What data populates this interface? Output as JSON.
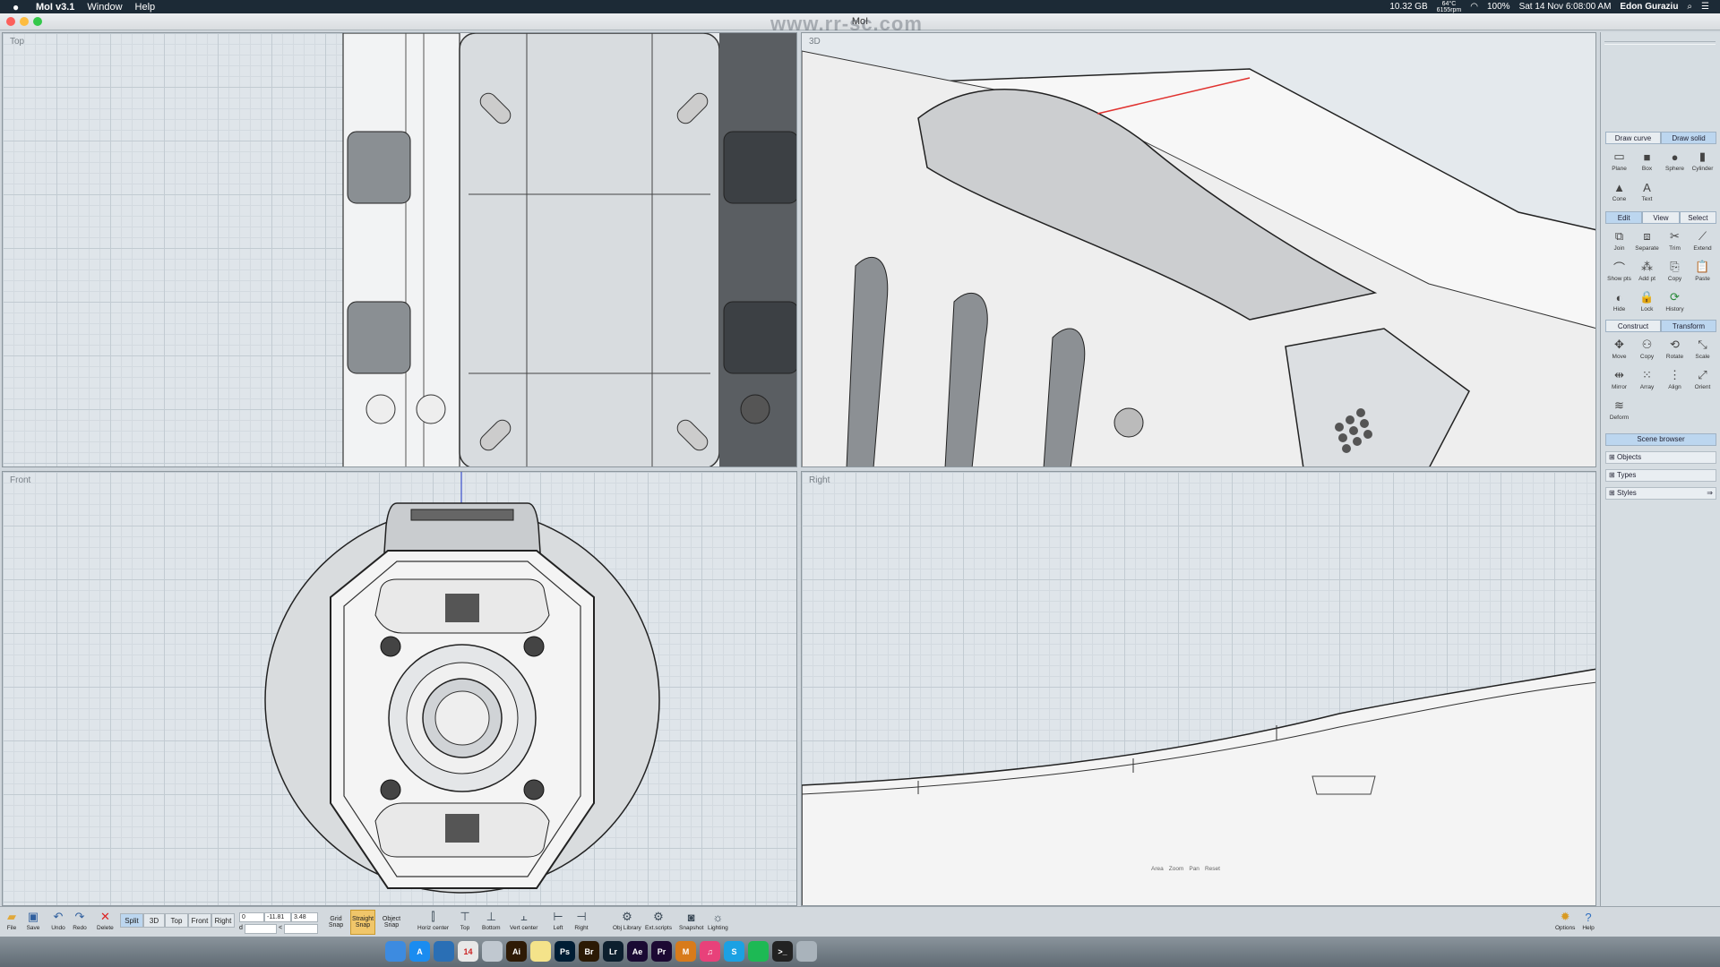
{
  "menubar": {
    "app_name": "MoI v3.1",
    "items": [
      "Window",
      "Help"
    ],
    "status": {
      "memory": "10.32 GB",
      "temp": "64°C",
      "fan": "6155rpm",
      "battery": "100%",
      "datetime": "Sat 14 Nov 6:08:00 AM",
      "user": "Edon Guraziu"
    }
  },
  "window": {
    "title": "MoI",
    "watermark": "www.rr-sc.com"
  },
  "viewports": {
    "top": "Top",
    "three_d": "3D",
    "front": "Front",
    "right": "Right"
  },
  "panel": {
    "draw_tabs": [
      "Draw curve",
      "Draw solid"
    ],
    "draw_tools": [
      {
        "label": "Plane",
        "icon": "plane-icon"
      },
      {
        "label": "Box",
        "icon": "box-icon"
      },
      {
        "label": "Sphere",
        "icon": "sphere-icon"
      },
      {
        "label": "Cylinder",
        "icon": "cylinder-icon"
      },
      {
        "label": "Cone",
        "icon": "cone-icon"
      },
      {
        "label": "Text",
        "icon": "text-icon"
      }
    ],
    "edit_tabs": [
      "Edit",
      "View",
      "Select"
    ],
    "edit_tools": [
      {
        "label": "Join",
        "icon": "join-icon"
      },
      {
        "label": "Separate",
        "icon": "separate-icon"
      },
      {
        "label": "Trim",
        "icon": "trim-icon"
      },
      {
        "label": "Extend",
        "icon": "extend-icon"
      },
      {
        "label": "Show pts",
        "icon": "show-points-icon"
      },
      {
        "label": "Add pt",
        "icon": "add-point-icon"
      },
      {
        "label": "Copy",
        "icon": "copy-icon"
      },
      {
        "label": "Paste",
        "icon": "paste-icon"
      },
      {
        "label": "Hide",
        "icon": "hide-icon"
      },
      {
        "label": "Lock",
        "icon": "lock-icon"
      },
      {
        "label": "History",
        "icon": "history-icon"
      }
    ],
    "transform_tabs": [
      "Construct",
      "Transform"
    ],
    "transform_tools": [
      {
        "label": "Move",
        "icon": "move-icon"
      },
      {
        "label": "Copy",
        "icon": "copy-icon"
      },
      {
        "label": "Rotate",
        "icon": "rotate-icon"
      },
      {
        "label": "Scale",
        "icon": "scale-icon"
      },
      {
        "label": "Mirror",
        "icon": "mirror-icon"
      },
      {
        "label": "Array",
        "icon": "array-icon"
      },
      {
        "label": "Align",
        "icon": "align-icon"
      },
      {
        "label": "Orient",
        "icon": "orient-icon"
      },
      {
        "label": "Deform",
        "icon": "deform-icon"
      }
    ],
    "scene_browser": "Scene browser",
    "scene_rows": [
      "Objects",
      "Types",
      "Styles"
    ]
  },
  "bottombar": {
    "file_buttons": [
      {
        "label": "File",
        "icon": "folder-icon"
      },
      {
        "label": "Save",
        "icon": "save-icon"
      },
      {
        "label": "Undo",
        "icon": "undo-icon"
      },
      {
        "label": "Redo",
        "icon": "redo-icon"
      },
      {
        "label": "Delete",
        "icon": "delete-icon"
      }
    ],
    "view_buttons": [
      "Split",
      "3D",
      "Top",
      "Front",
      "Right"
    ],
    "active_view": "Split",
    "coords": {
      "x": "0",
      "y": "-11.81",
      "z": "3.48",
      "d_label": "d",
      "a_label": "<"
    },
    "snaps": [
      {
        "line1": "Grid",
        "line2": "Snap",
        "active": false
      },
      {
        "line1": "Straight",
        "line2": "Snap",
        "active": true
      },
      {
        "line1": "Object",
        "line2": "Snap",
        "active": false
      }
    ],
    "align_buttons": [
      "Horiz center",
      "Top",
      "Bottom",
      "Vert center",
      "Left",
      "Right"
    ],
    "tool_buttons": [
      {
        "label": "Obj Library",
        "icon": "library-icon"
      },
      {
        "label": "Ext.scripts",
        "icon": "scripts-icon"
      },
      {
        "label": "Snapshot",
        "icon": "camera-icon"
      },
      {
        "label": "Lighting",
        "icon": "light-icon"
      }
    ],
    "right_buttons": [
      {
        "label": "Options",
        "icon": "options-icon"
      },
      {
        "label": "Help",
        "icon": "help-icon"
      }
    ]
  },
  "viewport_nav": [
    "Area",
    "Zoom",
    "Pan",
    "Reset"
  ],
  "dock": {
    "apps": [
      {
        "name": "finder",
        "short": "",
        "color": "#3d8be0"
      },
      {
        "name": "appstore",
        "short": "A",
        "color": "#1a8cf0"
      },
      {
        "name": "safari",
        "short": "",
        "color": "#2a6fb5"
      },
      {
        "name": "calendar",
        "short": "14",
        "color": "#e8e8e8"
      },
      {
        "name": "preview",
        "short": "",
        "color": "#c0c8d0"
      },
      {
        "name": "illustrator",
        "short": "Ai",
        "color": "#2e1a05"
      },
      {
        "name": "notes",
        "short": "",
        "color": "#f4e38a"
      },
      {
        "name": "photoshop",
        "short": "Ps",
        "color": "#001d34"
      },
      {
        "name": "bridge",
        "short": "Br",
        "color": "#2b1a05"
      },
      {
        "name": "lightroom",
        "short": "Lr",
        "color": "#0c1f2e"
      },
      {
        "name": "aftereffects",
        "short": "Ae",
        "color": "#1a0a33"
      },
      {
        "name": "premiere",
        "short": "Pr",
        "color": "#1c0933"
      },
      {
        "name": "moi",
        "short": "M",
        "color": "#d87b1b"
      },
      {
        "name": "music",
        "short": "♫",
        "color": "#e8417a"
      },
      {
        "name": "skype",
        "short": "S",
        "color": "#1ba1e3"
      },
      {
        "name": "spotify",
        "short": "",
        "color": "#1db954"
      },
      {
        "name": "terminal",
        "short": ">_",
        "color": "#222"
      },
      {
        "name": "trash",
        "short": "",
        "color": "#a9b3bb"
      }
    ]
  }
}
